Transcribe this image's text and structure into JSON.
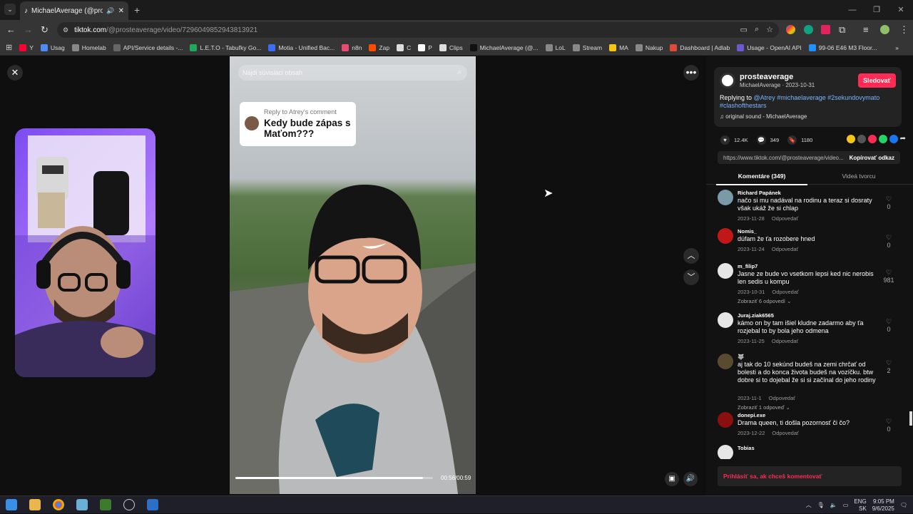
{
  "browser": {
    "tab_title": "MichaelAverage (@proste",
    "tab_menu_glyph": "⌄",
    "new_tab_glyph": "+",
    "url_domain": "tiktok.com",
    "url_path": "/@prosteaverage/video/7296049852943813921",
    "window_controls": [
      "—",
      "❐",
      "✕"
    ]
  },
  "bookmarks": [
    {
      "label": "Y",
      "color": "#ff0033"
    },
    {
      "label": "Usag",
      "color": "#4d8cf5"
    },
    {
      "label": "Homelab",
      "color": "#888888"
    },
    {
      "label": "API/Service details -...",
      "color": "#666666"
    },
    {
      "label": "L.E.T.O - Tabuľky Go...",
      "color": "#22a85a"
    },
    {
      "label": "Motia - Unified Bac...",
      "color": "#3a6df0"
    },
    {
      "label": "n8n",
      "color": "#ea4b71"
    },
    {
      "label": "Zap",
      "color": "#ff4a00"
    },
    {
      "label": "C",
      "color": "#dddddd"
    },
    {
      "label": "P",
      "color": "#ffffff"
    },
    {
      "label": "Clips",
      "color": "#dddddd"
    },
    {
      "label": "MichaelAverage (@...",
      "color": "#111111"
    },
    {
      "label": "LoL",
      "color": "#888888"
    },
    {
      "label": "Stream",
      "color": "#888888"
    },
    {
      "label": "MA",
      "color": "#f5c518"
    },
    {
      "label": "Nakup",
      "color": "#888888"
    },
    {
      "label": "Dashboard | Adlab",
      "color": "#e04a3a"
    },
    {
      "label": "Usage - OpenAI API",
      "color": "#6a5acd"
    },
    {
      "label": "99-06 E46 M3 Floor...",
      "color": "#1e90ff"
    }
  ],
  "player": {
    "close_glyph": "✕",
    "search_placeholder": "Nájdi súvisiaci obsah",
    "reply_prefix": "Reply to Atrey's comment",
    "reply_question": "Kedy bude zápas s Maťom???",
    "time": "00:56/00:59",
    "progress": 0.95,
    "more_glyph": "•••",
    "up_glyph": "︿",
    "down_glyph": "﹀"
  },
  "author": {
    "handle": "prosteaverage",
    "name_date": "MichaelAverage · 2023-10-31",
    "follow_label": "Sledovať",
    "desc_prefix": "Replying to",
    "desc_tags": "@Atrey #michaelaverage #2sekundovymato #clashofthestars",
    "sound": "♫  original sound - MichaelAverage"
  },
  "stats": {
    "likes": "12.4K",
    "comments": "349",
    "saves": "1180"
  },
  "share_colors": [
    "#f5c518",
    "#555555",
    "#fe2c55",
    "#25d366",
    "#1877f2"
  ],
  "link": {
    "url": "https://www.tiktok.com/@prosteaverage/video...",
    "copy_label": "Kopírovať odkaz"
  },
  "tabs": {
    "comments": "Komentáre (349)",
    "creator_videos": "Videá tvorcu"
  },
  "comments": [
    {
      "user": "Richard Papánek",
      "text": "načo si mu nadával na rodinu a teraz si dosraty však ukáž že si chlap",
      "date": "2023-11-28",
      "likes": "0",
      "avatar": "#7a9aa8"
    },
    {
      "user": "Nomis_",
      "text": "dúfam že ťa rozobere hned",
      "date": "2023-11-24",
      "likes": "0",
      "avatar": "#c01818"
    },
    {
      "user": "m_filip7",
      "text": "Jasne ze bude vo vsetkom lepsi ked nic nerobis len sedis u kompu",
      "date": "2023-10-31",
      "likes": "981",
      "more": "Zobraziť 6 odpovedí ⌄",
      "avatar": "#e6e6e6"
    },
    {
      "user": "Juraj.ziak6565",
      "text": "kámo on by tam išiel kludne zadarmo aby ťa rozjebal to by bola jeho odmena",
      "date": "2023-11-25",
      "likes": "0",
      "avatar": "#e6e6e6"
    },
    {
      "user": "🐺",
      "text": "aj tak do 10 sekúnd budeš na zemi chrčať od bolesti a do konca života budeš na vozíčku. btw dobre si to dojebal že si si začínal do jeho rodiny",
      "date": "2023-11-1",
      "likes": "2",
      "more": "Zobraziť 1 odpoveď ⌄",
      "avatar": "#5a4a30"
    },
    {
      "user": "donepi.exe",
      "text": "Drama queen, ti došla pozornosť či čo?",
      "date": "2023-12-22",
      "likes": "0",
      "avatar": "#8a1010"
    },
    {
      "user": "Tobias",
      "text": "",
      "date": "",
      "likes": "",
      "avatar": "#e6e6e6"
    }
  ],
  "reply_label": "Odpovedať",
  "login_prompt": "Prihlásiť sa, ak chceš komentovať",
  "taskbar": {
    "lang": "ENG",
    "region": "SK",
    "time": "9:05 PM",
    "date": "9/6/2025"
  }
}
